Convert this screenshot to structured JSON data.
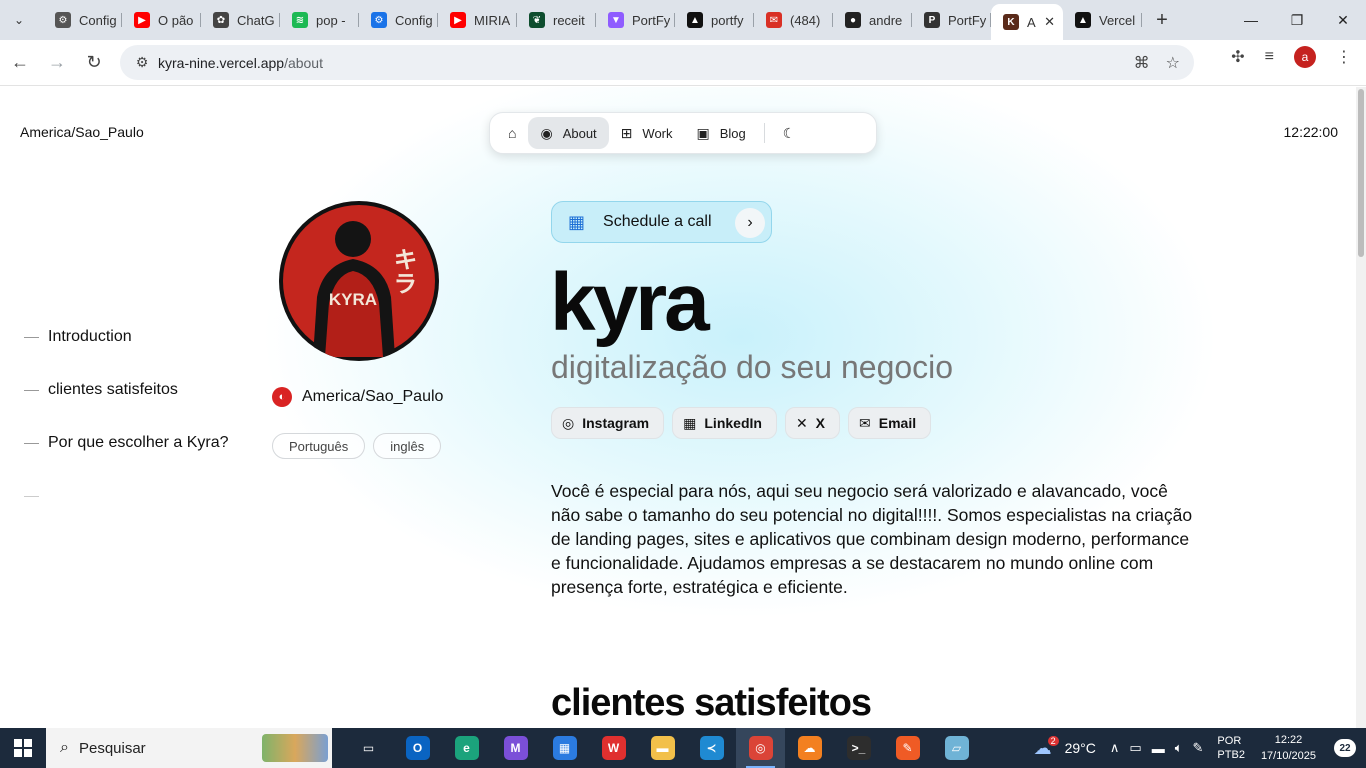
{
  "browser": {
    "tabs": [
      {
        "title": "Config",
        "icon": "settings-icon",
        "color": "#555555",
        "glyph": "⚙"
      },
      {
        "title": "O pão",
        "icon": "youtube-icon",
        "color": "#ff0000",
        "glyph": "▶"
      },
      {
        "title": "ChatG",
        "icon": "chatgpt-icon",
        "color": "#444444",
        "glyph": "✿"
      },
      {
        "title": "pop -",
        "icon": "spotify-icon",
        "color": "#1db954",
        "glyph": "≋"
      },
      {
        "title": "Config",
        "icon": "gear-icon",
        "color": "#1a73e8",
        "glyph": "⚙"
      },
      {
        "title": "MIRIA",
        "icon": "youtube-icon",
        "color": "#ff0000",
        "glyph": "▶"
      },
      {
        "title": "receit",
        "icon": "mongodb-icon",
        "color": "#0e4d2e",
        "glyph": "❦"
      },
      {
        "title": "PortFy",
        "icon": "vite-icon",
        "color": "#8f5cff",
        "glyph": "▼"
      },
      {
        "title": "portfy",
        "icon": "vercel-icon",
        "color": "#111111",
        "glyph": "▲"
      },
      {
        "title": "(484)",
        "icon": "mail-icon",
        "color": "#d93025",
        "glyph": "✉"
      },
      {
        "title": "andre",
        "icon": "github-icon",
        "color": "#222222",
        "glyph": "●"
      },
      {
        "title": "PortFy",
        "icon": "p-icon",
        "color": "#333333",
        "glyph": "P"
      },
      {
        "title": "A",
        "icon": "kyra-favicon-icon",
        "color": "#5a2a1a",
        "glyph": "K",
        "active": true
      },
      {
        "title": "Vercel",
        "icon": "vercel-icon",
        "color": "#111111",
        "glyph": "▲"
      }
    ],
    "url_host": "kyra-nine.vercel.app",
    "url_path": "/about",
    "profile_initial": "a"
  },
  "page": {
    "timezone": "America/Sao_Paulo",
    "clock": "12:22:00",
    "nav": [
      {
        "label": "",
        "icon": "home-icon",
        "glyph": "⌂"
      },
      {
        "label": "About",
        "icon": "person-icon",
        "glyph": "◉",
        "active": true
      },
      {
        "label": "Work",
        "icon": "grid-icon",
        "glyph": "⊞"
      },
      {
        "label": "Blog",
        "icon": "book-icon",
        "glyph": "▣"
      }
    ],
    "toc": [
      "Introduction",
      "clientes satisfeitos",
      "Por que escolher a Kyra?",
      ""
    ],
    "profile": {
      "avatar_text": "KYRA",
      "avatar_kana": "キラ",
      "location": "America/Sao_Paulo",
      "languages": [
        "Português",
        "inglês"
      ]
    },
    "schedule_label": "Schedule a call",
    "name": "kyra",
    "tagline": "digitalização do seu negocio",
    "socials": [
      {
        "label": "Instagram",
        "icon": "instagram-icon",
        "glyph": "◎"
      },
      {
        "label": "LinkedIn",
        "icon": "linkedin-icon",
        "glyph": "▦"
      },
      {
        "label": "X",
        "icon": "x-icon",
        "glyph": "✕"
      },
      {
        "label": "Email",
        "icon": "email-icon",
        "glyph": "✉"
      }
    ],
    "intro": "Você é especial para nós, aqui seu negocio será valorizado e alavancado, você não sabe o tamanho do seu potencial no digital!!!!. Somos especialistas na criação de landing pages, sites e aplicativos que combinam design moderno, performance e funcionalidade. Ajudamos empresas a se destacarem no mundo online com presença forte, estratégica e eficiente.",
    "section_heading": "clientes satisfeitos"
  },
  "taskbar": {
    "search_placeholder": "Pesquisar",
    "apps": [
      {
        "icon": "task-view-icon",
        "color": "#1c2a3c",
        "glyph": "▭"
      },
      {
        "icon": "outlook-icon",
        "color": "#0a64c2",
        "glyph": "O"
      },
      {
        "icon": "edge-icon",
        "color": "#1ba37c",
        "glyph": "e"
      },
      {
        "icon": "m365-icon",
        "color": "#7b4fd8",
        "glyph": "M"
      },
      {
        "icon": "store-icon",
        "color": "#2b7be0",
        "glyph": "▦"
      },
      {
        "icon": "wps-icon",
        "color": "#e0302f",
        "glyph": "W"
      },
      {
        "icon": "file-explorer-icon",
        "color": "#f2c04a",
        "glyph": "▬"
      },
      {
        "icon": "vscode-icon",
        "color": "#1f8ad2",
        "glyph": "≺"
      },
      {
        "icon": "chrome-icon",
        "color": "#db4437",
        "glyph": "◎",
        "active": true
      },
      {
        "icon": "cloudflare-icon",
        "color": "#f38020",
        "glyph": "☁"
      },
      {
        "icon": "terminal-icon",
        "color": "#2d2d2d",
        "glyph": ">_"
      },
      {
        "icon": "postman-icon",
        "color": "#ef5b25",
        "glyph": "✎"
      },
      {
        "icon": "notes-icon",
        "color": "#6fb3d6",
        "glyph": "▱"
      }
    ],
    "weather_badge": "2",
    "temperature": "29°C",
    "lang_line1": "POR",
    "lang_line2": "PTB2",
    "time": "12:22",
    "date": "17/10/2025",
    "notifications": "22"
  }
}
